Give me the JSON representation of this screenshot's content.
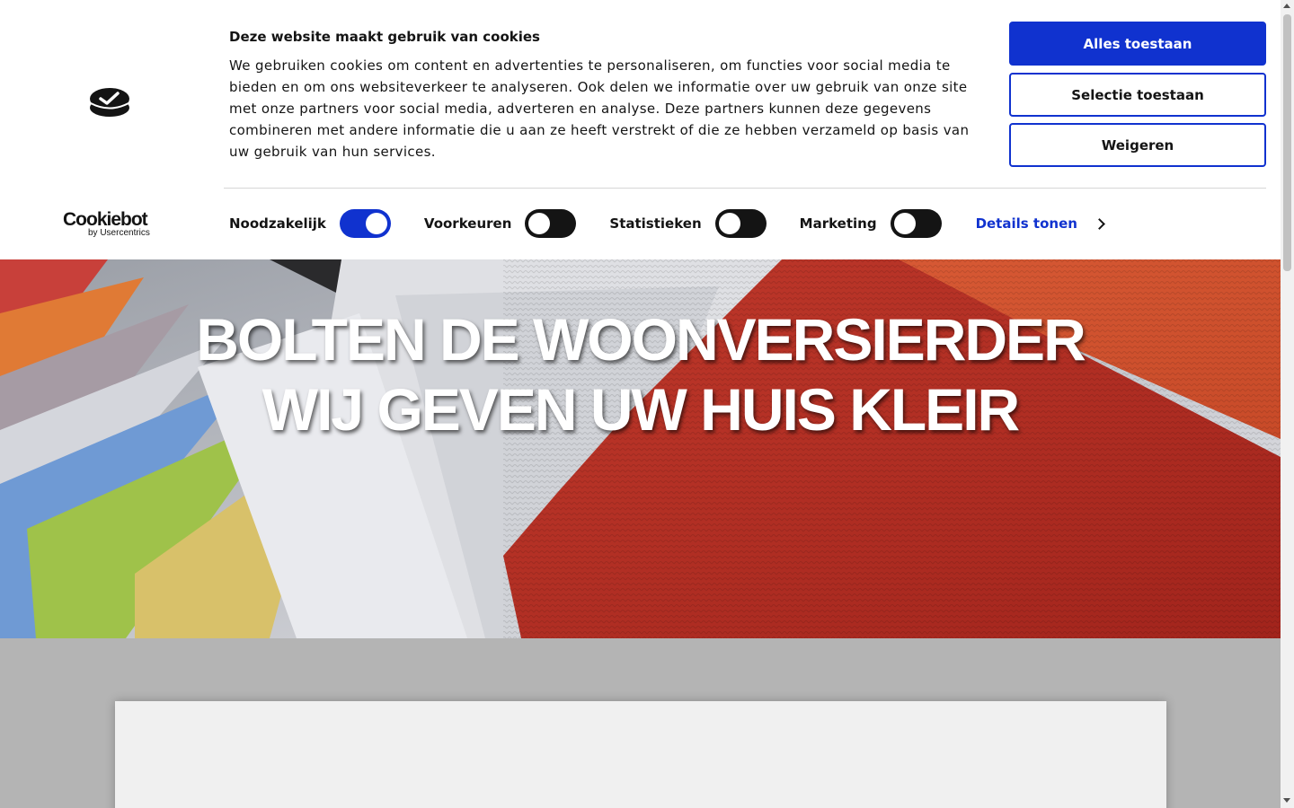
{
  "cookie_banner": {
    "title": "Deze website maakt gebruik van cookies",
    "text": "We gebruiken cookies om content en advertenties te personaliseren, om functies voor social media te bieden en om ons websiteverkeer te analyseren. Ook delen we informatie over uw gebruik van onze site met onze partners voor social media, adverteren en analyse. Deze partners kunnen deze gegevens combineren met andere informatie die u aan ze heeft verstrekt of die ze hebben verzameld op basis van uw gebruik van hun services.",
    "brand": {
      "name": "Cookiebot",
      "sub": "by Usercentrics",
      "logo_icon": "cookiebot-logo-icon"
    },
    "buttons": {
      "allow_all": "Alles toestaan",
      "allow_selection": "Selectie toestaan",
      "deny": "Weigeren"
    },
    "toggles": [
      {
        "label": "Noodzakelijk",
        "checked": true
      },
      {
        "label": "Voorkeuren",
        "checked": false
      },
      {
        "label": "Statistieken",
        "checked": false
      },
      {
        "label": "Marketing",
        "checked": false
      }
    ],
    "details_link": "Details tonen",
    "accent_color": "#1032cf"
  },
  "hero": {
    "line1": "BOLTEN DE WOONVERSIERDER",
    "line2": "WIJ GEVEN UW HUIS KLEIR"
  }
}
